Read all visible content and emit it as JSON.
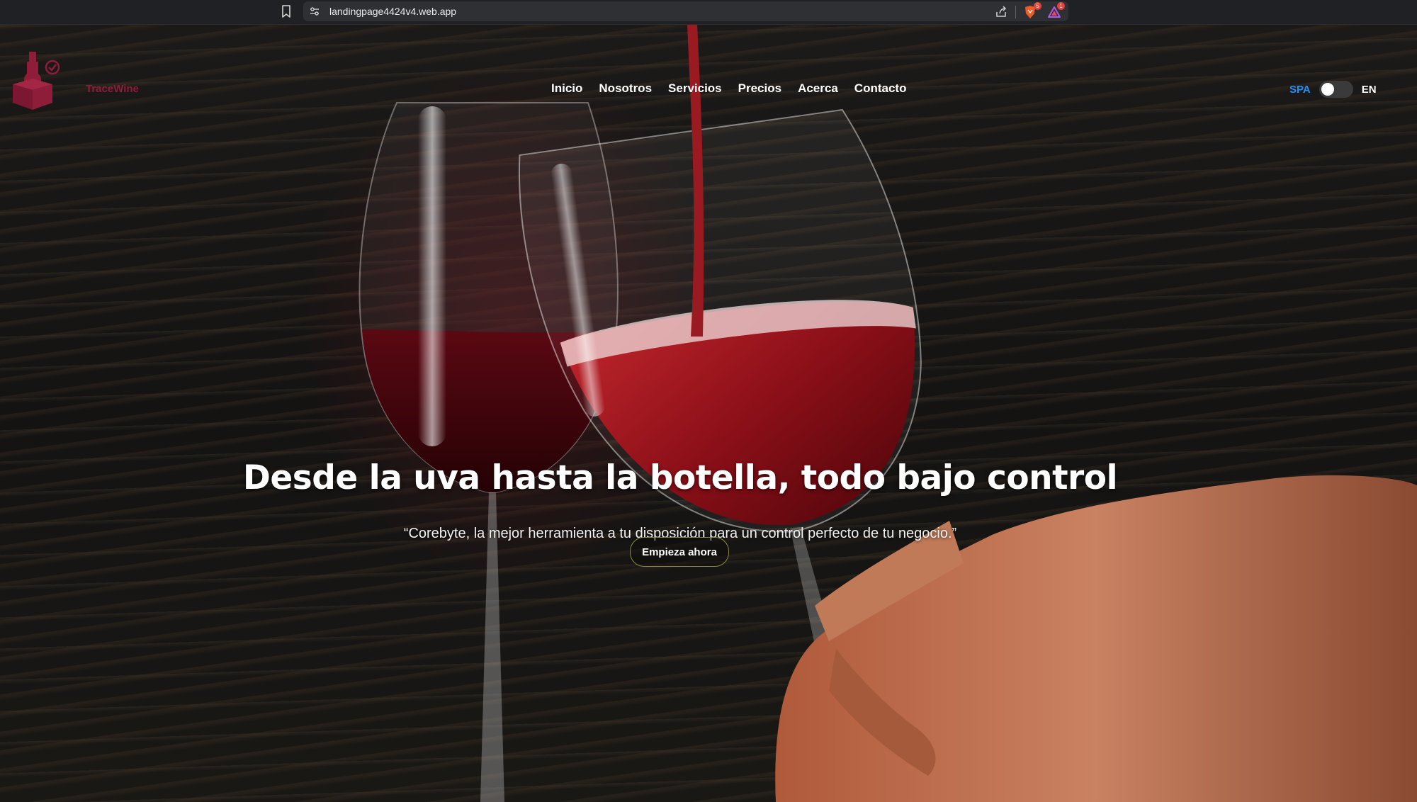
{
  "browser": {
    "url": "landingpage4424v4.web.app",
    "brave_badge": "5",
    "rewards_badge": "1"
  },
  "header": {
    "brand": "TraceWine",
    "nav": [
      {
        "label": "Inicio"
      },
      {
        "label": "Nosotros"
      },
      {
        "label": "Servicios"
      },
      {
        "label": "Precios"
      },
      {
        "label": "Acerca"
      },
      {
        "label": "Contacto"
      }
    ],
    "language": {
      "left_label": "SPA",
      "right_label": "EN",
      "selected": "SPA"
    }
  },
  "hero": {
    "headline": "Desde la uva hasta la botella, todo bajo control",
    "subtitle": "“Corebyte, la mejor herramienta a tu disposición para un control perfecto de tu negocio.”",
    "cta_label": "Empieza ahora"
  },
  "colors": {
    "brand": "#8e1d3a",
    "accent": "#1e8fff",
    "cta_border": "#8a8a3a",
    "wine": "#7a0f1c"
  },
  "icons": {
    "bookmark": "bookmark-icon",
    "site_settings": "tune-icon",
    "share": "share-icon",
    "brave": "brave-shield-icon",
    "rewards": "brave-rewards-icon",
    "logo": "wine-box-check-icon"
  }
}
